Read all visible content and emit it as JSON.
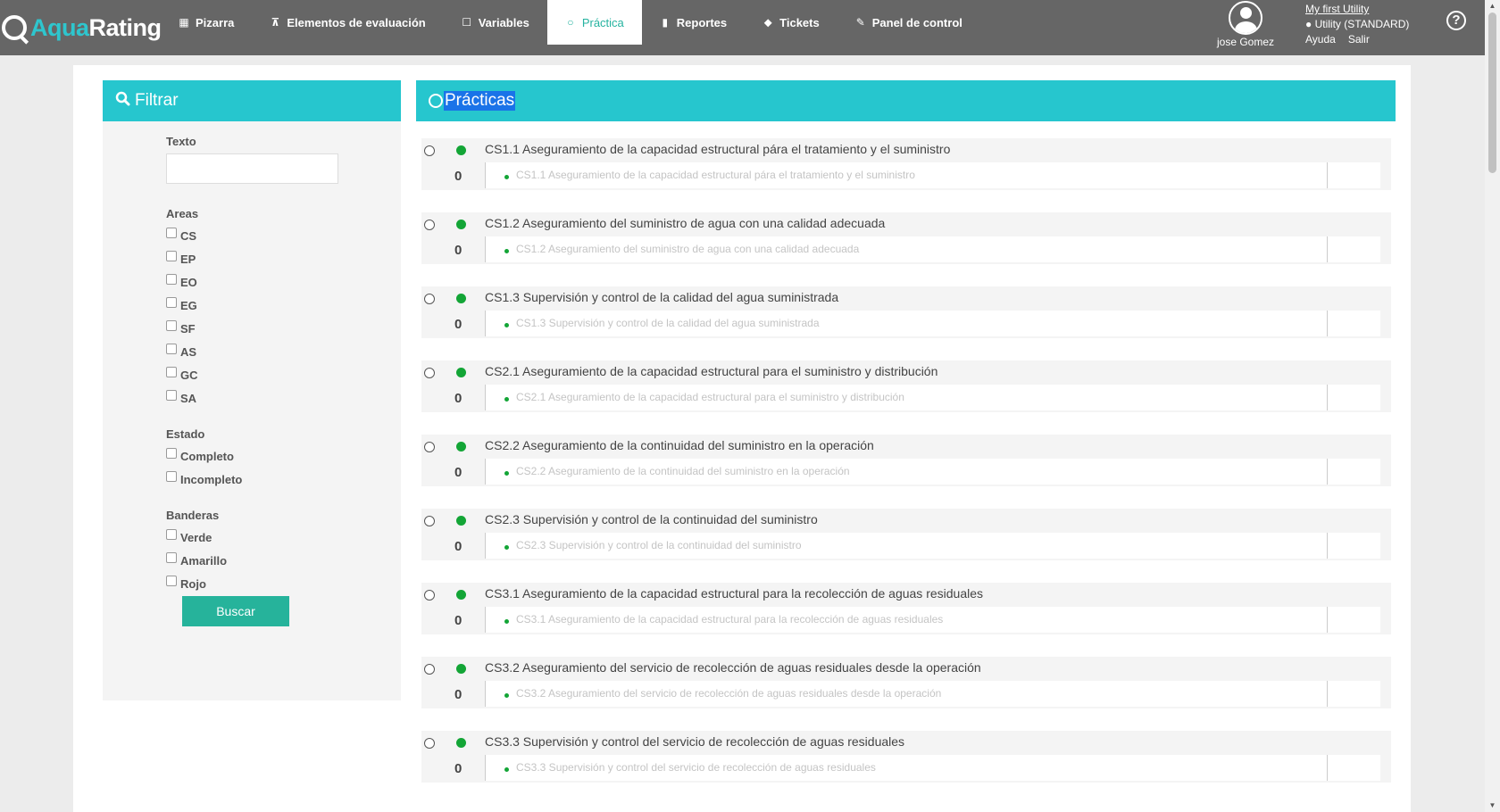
{
  "logo": {
    "part1": "Aqua",
    "part2": "Rating"
  },
  "nav": [
    {
      "label": "Pizarra",
      "icon": "dashboard-icon",
      "glyph": "▦",
      "active": false
    },
    {
      "label": "Elementos de evaluación",
      "icon": "sitemap-icon",
      "glyph": "⊼",
      "active": false
    },
    {
      "label": "Variables",
      "icon": "square-icon",
      "glyph": "☐",
      "active": false
    },
    {
      "label": "Práctica",
      "icon": "circle-icon",
      "glyph": "○",
      "active": true
    },
    {
      "label": "Reportes",
      "icon": "bar-chart-icon",
      "glyph": "▮",
      "active": false
    },
    {
      "label": "Tickets",
      "icon": "tags-icon",
      "glyph": "⬥",
      "active": false
    },
    {
      "label": "Panel de control",
      "icon": "wrench-icon",
      "glyph": "✎",
      "active": false
    }
  ],
  "user": {
    "name": "jose Gomez"
  },
  "utility": {
    "name": "My first Utility",
    "plan": "● Utility (STANDARD)",
    "help": "Ayuda",
    "logout": "Salir"
  },
  "filter": {
    "title": "Filtrar",
    "text_label": "Texto",
    "text_value": "",
    "areas_label": "Areas",
    "areas": [
      "CS",
      "EP",
      "EO",
      "EG",
      "SF",
      "AS",
      "GC",
      "SA"
    ],
    "estado_label": "Estado",
    "estado": [
      "Completo",
      "Incompleto"
    ],
    "banderas_label": "Banderas",
    "banderas": [
      "Verde",
      "Amarillo",
      "Rojo"
    ],
    "search_button": "Buscar"
  },
  "practices": {
    "title": "Prácticas",
    "items": [
      {
        "title": "CS1.1 Aseguramiento de la capacidad estructural pára el tratamiento y el suministro",
        "count": "0",
        "sub": "CS1.1 Aseguramiento de la capacidad estructural pára el tratamiento y el suministro"
      },
      {
        "title": "CS1.2 Aseguramiento del suministro de agua con una calidad adecuada",
        "count": "0",
        "sub": "CS1.2 Aseguramiento del suministro de agua con una calidad adecuada"
      },
      {
        "title": "CS1.3 Supervisión y control de la calidad del agua suministrada",
        "count": "0",
        "sub": "CS1.3 Supervisión y control de la calidad del agua suministrada"
      },
      {
        "title": "CS2.1 Aseguramiento de la capacidad estructural para el suministro y distribución",
        "count": "0",
        "sub": "CS2.1 Aseguramiento de la capacidad estructural para el suministro y distribución"
      },
      {
        "title": "CS2.2 Aseguramiento de la continuidad del suministro en la operación",
        "count": "0",
        "sub": "CS2.2 Aseguramiento de la continuidad del suministro en la operación"
      },
      {
        "title": "CS2.3 Supervisión y control de la continuidad del suministro",
        "count": "0",
        "sub": "CS2.3 Supervisión y control de la continuidad del suministro"
      },
      {
        "title": "CS3.1 Aseguramiento de la capacidad estructural para la recolección de aguas residuales",
        "count": "0",
        "sub": "CS3.1 Aseguramiento de la capacidad estructural para la recolección de aguas residuales"
      },
      {
        "title": "CS3.2 Aseguramiento del servicio de recolección de aguas residuales desde la operación",
        "count": "0",
        "sub": "CS3.2 Aseguramiento del servicio de recolección de aguas residuales desde la operación"
      },
      {
        "title": "CS3.3 Supervisión y control del servicio de recolección de aguas residuales",
        "count": "0",
        "sub": "CS3.3 Supervisión y control del servicio de recolección de aguas residuales"
      }
    ]
  },
  "colors": {
    "header": "#666666",
    "accent": "#26c6ce",
    "button": "#26b39b",
    "flag_green": "#13a536"
  }
}
